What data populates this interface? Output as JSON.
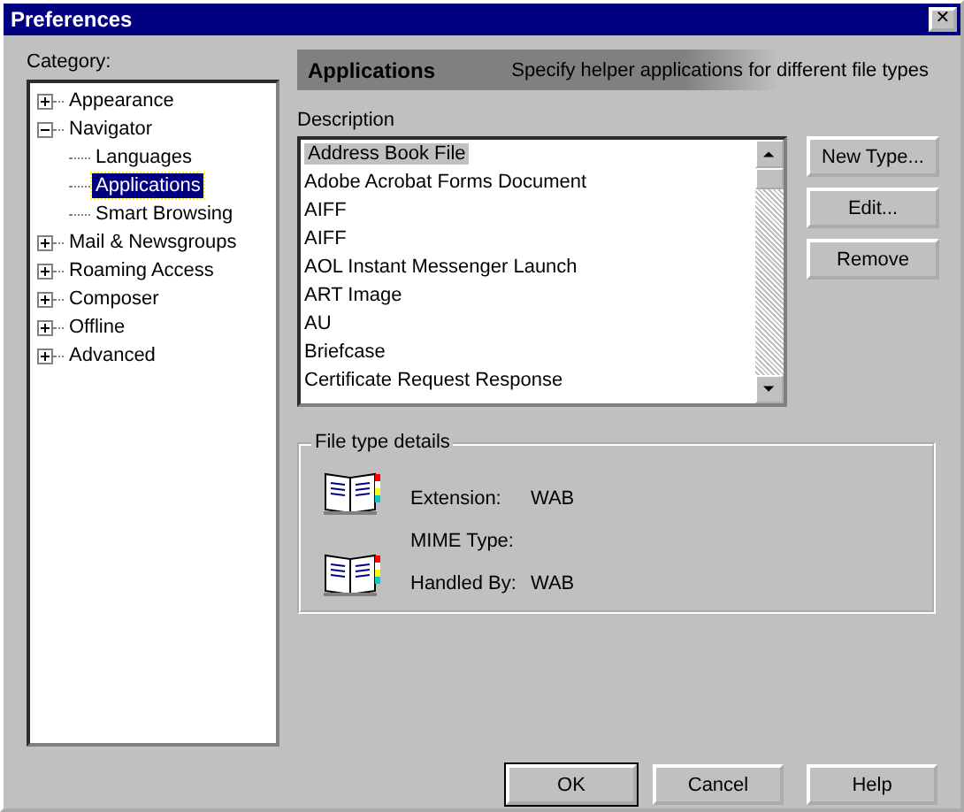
{
  "window": {
    "title": "Preferences",
    "close": "✕"
  },
  "category": {
    "label": "Category:",
    "items": [
      {
        "label": "Appearance",
        "expanded": false,
        "selected": false
      },
      {
        "label": "Navigator",
        "expanded": true,
        "selected": false,
        "children": [
          {
            "label": "Languages",
            "selected": false
          },
          {
            "label": "Applications",
            "selected": true
          },
          {
            "label": "Smart Browsing",
            "selected": false
          }
        ]
      },
      {
        "label": "Mail & Newsgroups",
        "expanded": false,
        "selected": false
      },
      {
        "label": "Roaming Access",
        "expanded": false,
        "selected": false
      },
      {
        "label": "Composer",
        "expanded": false,
        "selected": false
      },
      {
        "label": "Offline",
        "expanded": false,
        "selected": false
      },
      {
        "label": "Advanced",
        "expanded": false,
        "selected": false
      }
    ]
  },
  "header": {
    "title": "Applications",
    "subtitle": "Specify helper applications for different file types"
  },
  "description": {
    "label": "Description",
    "items": [
      {
        "label": "Address Book File",
        "selected": true
      },
      {
        "label": "Adobe Acrobat Forms Document",
        "selected": false
      },
      {
        "label": "AIFF",
        "selected": false
      },
      {
        "label": "AIFF",
        "selected": false
      },
      {
        "label": "AOL Instant Messenger Launch",
        "selected": false
      },
      {
        "label": "ART Image",
        "selected": false
      },
      {
        "label": "AU",
        "selected": false
      },
      {
        "label": "Briefcase",
        "selected": false
      },
      {
        "label": "Certificate Request Response",
        "selected": false
      }
    ]
  },
  "side_buttons": [
    "New Type...",
    "Edit...",
    "Remove"
  ],
  "details": {
    "legend": "File type details",
    "fields": [
      {
        "label": "Extension:",
        "value": "WAB"
      },
      {
        "label": "MIME Type:"
      },
      {
        "label": "Handled By:",
        "value": "WAB"
      }
    ]
  },
  "buttons": [
    "OK",
    "Cancel",
    "Help"
  ]
}
